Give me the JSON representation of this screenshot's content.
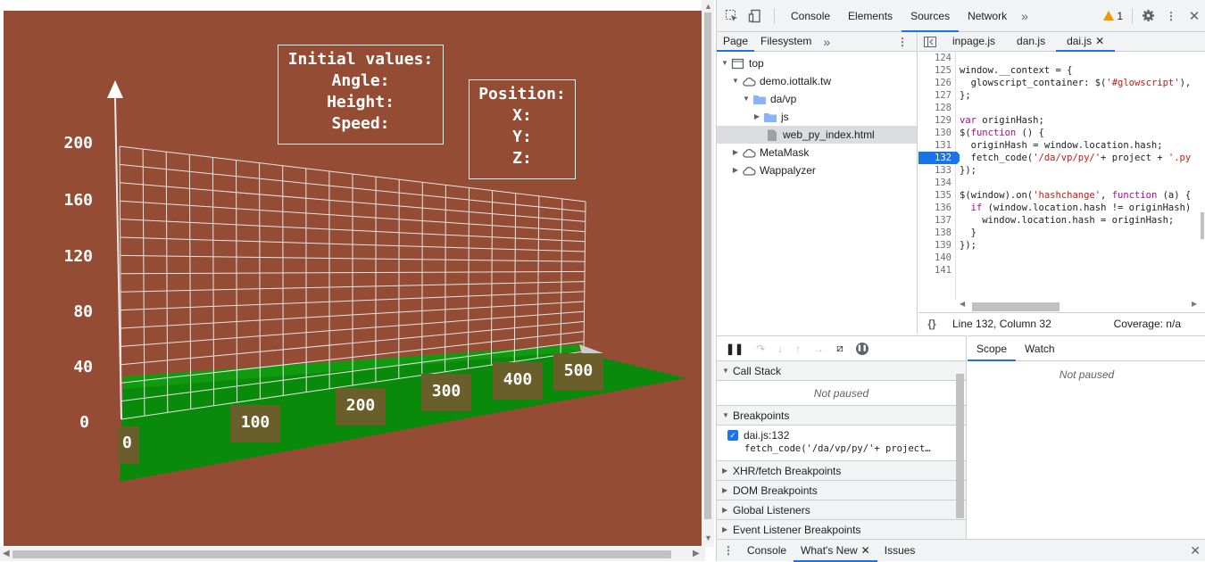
{
  "scene": {
    "background": "#954c34",
    "y_ticks": [
      "200",
      "160",
      "120",
      "80",
      "40",
      "0"
    ],
    "x_ticks": [
      "0",
      "100",
      "200",
      "300",
      "400",
      "500"
    ],
    "initial_values": {
      "title": "Initial values:",
      "angle": "Angle:",
      "height": "Height:",
      "speed": "Speed:"
    },
    "position": {
      "title": "Position:",
      "x": "X:",
      "y": "Y:",
      "z": "Z:"
    }
  },
  "devtools": {
    "main_tabs": [
      "Console",
      "Elements",
      "Sources",
      "Network"
    ],
    "active_tab": "Sources",
    "warning_count": "1",
    "navigator": {
      "tabs": [
        "Page",
        "Filesystem"
      ],
      "tree": [
        {
          "label": "top",
          "icon": "frame-icon"
        },
        {
          "label": "demo.iottalk.tw",
          "icon": "cloud-icon"
        },
        {
          "label": "da/vp",
          "icon": "folder-icon"
        },
        {
          "label": "js",
          "icon": "folder-icon"
        },
        {
          "label": "web_py_index.html",
          "icon": "file-icon"
        },
        {
          "label": "MetaMask",
          "icon": "cloud-icon"
        },
        {
          "label": "Wappalyzer",
          "icon": "cloud-icon"
        }
      ]
    },
    "editor": {
      "file_tabs": [
        "inpage.js",
        "dan.js",
        "dai.js"
      ],
      "active_file": "dai.js",
      "line_numbers": [
        "124",
        "125",
        "126",
        "127",
        "128",
        "129",
        "130",
        "131",
        "132",
        "133",
        "134",
        "135",
        "136",
        "137",
        "138",
        "139",
        "140",
        "141"
      ],
      "breakpoint_line": "132",
      "status_position": "Line 132, Column 32",
      "coverage": "Coverage: n/a"
    },
    "debugger": {
      "call_stack": "Call Stack",
      "not_paused": "Not paused",
      "breakpoints": "Breakpoints",
      "bp_file": "dai.js:132",
      "bp_code": "fetch_code('/da/vp/py/'+ project…",
      "sections": [
        "XHR/fetch Breakpoints",
        "DOM Breakpoints",
        "Global Listeners",
        "Event Listener Breakpoints"
      ]
    },
    "scope": {
      "tabs": [
        "Scope",
        "Watch"
      ],
      "not_paused": "Not paused"
    },
    "drawer": {
      "tabs": [
        "Console",
        "What's New",
        "Issues"
      ]
    }
  }
}
